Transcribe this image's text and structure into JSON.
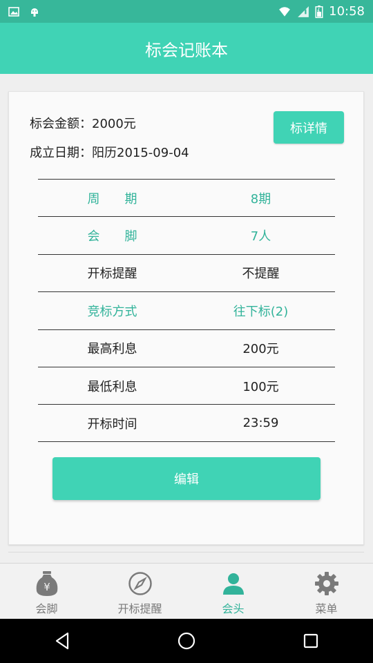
{
  "status": {
    "time": "10:58",
    "icons": [
      "image-icon",
      "android-icon",
      "wifi-icon",
      "signal-icon",
      "battery-icon"
    ]
  },
  "header": {
    "title": "标会记账本"
  },
  "summary": {
    "amount_text": "标会金额：2000元",
    "date_text": "成立日期：阳历2015-09-04",
    "detail_button": "标详情"
  },
  "table": {
    "rows": [
      {
        "label": "周　　期",
        "value": "8期",
        "color": "#32b39a"
      },
      {
        "label": "会　　脚",
        "value": "7人",
        "color": "#32b39a"
      },
      {
        "label": "开标提醒",
        "value": "不提醒",
        "color": "#222222"
      },
      {
        "label": "竞标方式",
        "value": "往下标(2)",
        "color": "#32b39a"
      },
      {
        "label": "最高利息",
        "value": "200元",
        "color": "#222222"
      },
      {
        "label": "最低利息",
        "value": "100元",
        "color": "#222222"
      },
      {
        "label": "开标时间",
        "value": "23:59",
        "color": "#222222"
      }
    ]
  },
  "edit_button": "编辑",
  "tabs": [
    {
      "label": "会脚",
      "icon": "money-bag-icon",
      "active": false
    },
    {
      "label": "开标提醒",
      "icon": "compass-icon",
      "active": false
    },
    {
      "label": "会头",
      "icon": "person-icon",
      "active": true
    },
    {
      "label": "菜单",
      "icon": "gear-icon",
      "active": false
    }
  ],
  "colors": {
    "accent": "#40d3b5",
    "statusbar": "#37b79a",
    "teal_text": "#32b39a",
    "inactive_tab": "#7a7a7a"
  },
  "nav": [
    "back-icon",
    "home-icon",
    "recents-icon"
  ]
}
